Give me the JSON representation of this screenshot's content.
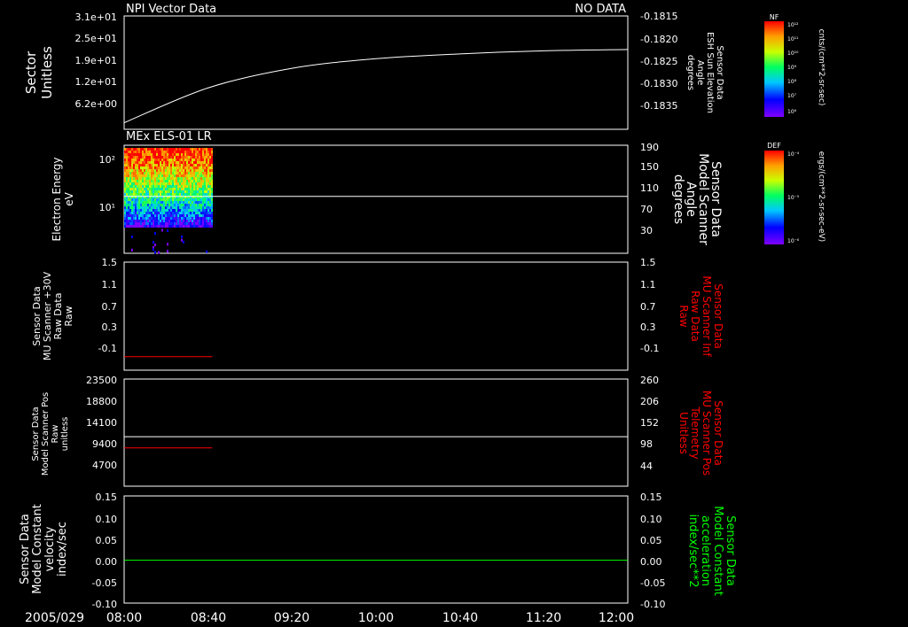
{
  "date_label": "2005/029",
  "time_ticks": [
    "08:00",
    "08:40",
    "09:20",
    "10:00",
    "10:40",
    "11:20",
    "12:00"
  ],
  "colors": {
    "background": "#000000",
    "axis": "#ffffff",
    "red_series": "#ff0000",
    "green_series": "#00ff00"
  },
  "panels": [
    {
      "id": "npi",
      "title": "NPI Vector Data",
      "status": "NO DATA",
      "left_label": [
        "Sector",
        "Unitless"
      ],
      "left_ticks": [
        "3.1e+01",
        "2.5e+01",
        "1.9e+01",
        "1.2e+01",
        "6.2e+00"
      ],
      "right_label": [
        "Sensor Data",
        "ESH Sun Elevation",
        "Angle",
        "degrees"
      ],
      "right_ticks": [
        "-0.1815",
        "-0.1820",
        "-0.1825",
        "-0.1830",
        "-0.1835"
      ]
    },
    {
      "id": "els",
      "title": "MEx ELS-01 LR",
      "left_label": [
        "Electron Energy",
        "eV"
      ],
      "left_ticks": [
        "10²",
        "10¹"
      ],
      "right_label": [
        "Sensor Data",
        "Model Scanner",
        "Angle",
        "degrees"
      ],
      "right_ticks": [
        "190",
        "150",
        "110",
        "70",
        "30"
      ]
    },
    {
      "id": "scanner-raw",
      "left_label": [
        "Sensor Data",
        "MU Scanner +30V",
        "Raw Data",
        "Raw"
      ],
      "left_ticks": [
        "1.5",
        "1.1",
        "0.7",
        "0.3",
        "-0.1"
      ],
      "right_label": [
        "Sensor Data",
        "MU Scanner Inf",
        "Raw Data",
        "Raw"
      ],
      "right_ticks": [
        "1.5",
        "1.1",
        "0.7",
        "0.3",
        "-0.1"
      ]
    },
    {
      "id": "scanner-pos",
      "left_label": [
        "Sensor Data",
        "Model Scanner Pos",
        "Raw",
        "unitless"
      ],
      "left_ticks": [
        "23500",
        "18800",
        "14100",
        "9400",
        "4700"
      ],
      "right_label": [
        "Sensor Data",
        "MU Scanner Pos",
        "Telemetry",
        "Unitless"
      ],
      "right_ticks": [
        "260",
        "206",
        "152",
        "98",
        "44"
      ]
    },
    {
      "id": "velocity",
      "left_label": [
        "Sensor Data",
        "Model Constant",
        "velocity",
        "index/sec"
      ],
      "left_ticks": [
        "0.15",
        "0.10",
        "0.05",
        "0.00",
        "-0.05",
        "-0.10"
      ],
      "right_label": [
        "Sensor Data",
        "Model Constant",
        "acceleration",
        "index/sec**2"
      ],
      "right_ticks": [
        "0.15",
        "0.10",
        "0.05",
        "0.00",
        "-0.05",
        "-0.10"
      ]
    }
  ],
  "colorbars": [
    {
      "title": "NF",
      "unit": "cnts/(cm**2-sr-sec)",
      "ticks": [
        "10¹²",
        "10¹¹",
        "10¹⁰",
        "10⁹",
        "10⁸",
        "10⁷",
        "10⁶"
      ]
    },
    {
      "title": "DEF",
      "unit": "ergs/(cm**2-sr-sec-eV)",
      "ticks": [
        "10⁻⁴",
        "10⁻⁵",
        "10⁻⁶"
      ]
    }
  ],
  "chart_data": [
    {
      "type": "line",
      "title": "NPI Vector Data",
      "x": [
        "08:00",
        "08:40",
        "09:20",
        "10:00",
        "10:40",
        "11:20",
        "12:00"
      ],
      "series": [
        {
          "values": [
            -0.18365,
            -0.18285,
            -0.1824,
            -0.18218,
            -0.18207,
            -0.182,
            -0.18197
          ]
        }
      ],
      "ylim": [
        -0.1838,
        -0.1812
      ],
      "ylabel": "Sensor Data ESH Sun Elevation Angle degrees"
    },
    {
      "type": "heatmap",
      "title": "MEx ELS-01 LR",
      "x_range": [
        "08:00",
        "08:42"
      ],
      "ylabel": "Electron Energy eV",
      "ylim": [
        2,
        200
      ],
      "yscale": "log",
      "overlay_line": {
        "axis": "right",
        "value": 100,
        "ylim": [
          0,
          190
        ]
      }
    },
    {
      "type": "line",
      "x_range": [
        "08:00",
        "08:42"
      ],
      "series": [
        {
          "values": [
            -0.075
          ]
        }
      ],
      "ylim": [
        -0.3,
        1.5
      ]
    },
    {
      "type": "line",
      "x_range": [
        "08:00",
        "08:42"
      ],
      "series": [
        {
          "values": [
            8400
          ]
        }
      ],
      "ylim": [
        0,
        23500
      ],
      "overlay_line": {
        "axis": "right",
        "value": 120,
        "ylim": [
          0,
          260
        ]
      }
    },
    {
      "type": "line",
      "x": [
        "08:00",
        "12:00"
      ],
      "series": [
        {
          "values": [
            0.0,
            0.0
          ]
        }
      ],
      "ylim": [
        -0.1,
        0.15
      ]
    }
  ]
}
